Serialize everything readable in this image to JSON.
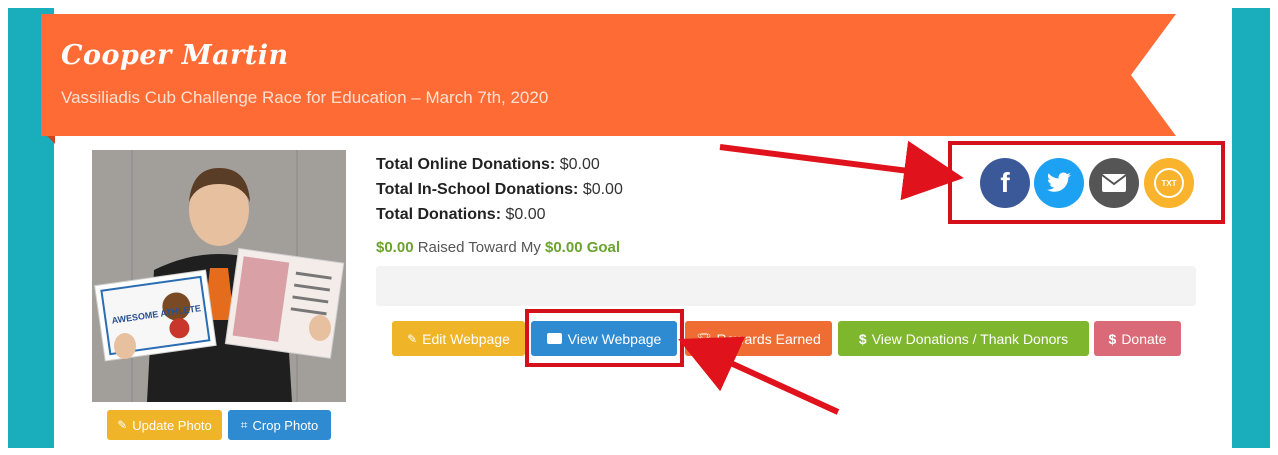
{
  "banner": {
    "name": "Cooper Martin",
    "subtitle": "Vassiliadis Cub Challenge Race for Education – March 7th, 2020"
  },
  "photo": {
    "alt": "Student holding Awesome Athlete certificates",
    "certificate_text": "AWESOME ATHLETE"
  },
  "photo_buttons": {
    "update": "Update Photo",
    "crop": "Crop Photo"
  },
  "stats": {
    "online_label": "Total Online Donations:",
    "online_value": "$0.00",
    "school_label": "Total In-School Donations:",
    "school_value": "$0.00",
    "total_label": "Total Donations:",
    "total_value": "$0.00"
  },
  "goal": {
    "raised": "$0.00",
    "middle_text": "Raised Toward My",
    "goal": "$0.00 Goal",
    "progress_fraction": 0
  },
  "actions": {
    "edit": "Edit Webpage",
    "view": "View Webpage",
    "rewards": "Rewards Earned",
    "donations": "View Donations / Thank Donors",
    "donate": "Donate"
  },
  "share": {
    "facebook_icon": "facebook-icon",
    "twitter_icon": "twitter-icon",
    "email_icon": "email-icon",
    "text_icon": "txt-icon",
    "text_label": "TXT"
  },
  "colors": {
    "banner": "#ff6b35",
    "frame": "#1aaebc",
    "facebook": "#3b5998",
    "twitter": "#1da1f2",
    "email": "#555555",
    "text": "#f9b32c",
    "highlight": "#d4101a"
  }
}
